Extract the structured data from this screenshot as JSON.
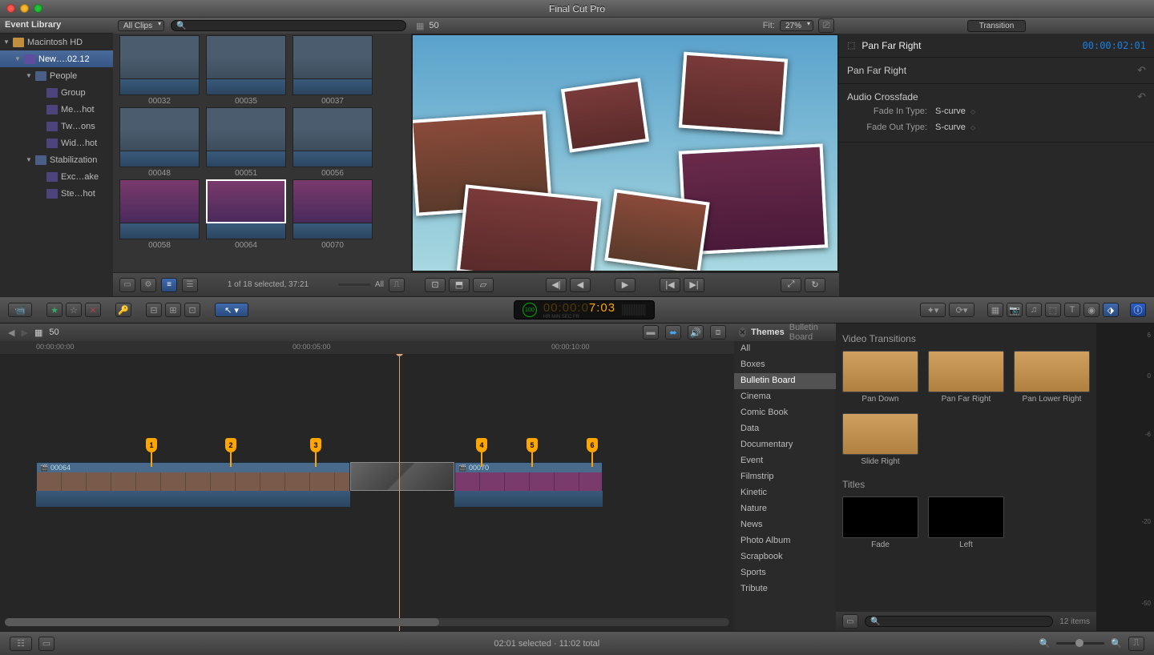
{
  "app": {
    "title": "Final Cut Pro"
  },
  "event_library": {
    "header": "Event Library",
    "tree": [
      {
        "icon": "drive",
        "label": "Macintosh HD",
        "indent": 0,
        "tri": true
      },
      {
        "icon": "event",
        "label": "New….02.12",
        "indent": 1,
        "tri": true,
        "sel": true
      },
      {
        "icon": "folder",
        "label": "People",
        "indent": 2,
        "tri": true
      },
      {
        "icon": "clip",
        "label": "Group",
        "indent": 3
      },
      {
        "icon": "clip",
        "label": "Me…hot",
        "indent": 3
      },
      {
        "icon": "clip",
        "label": "Tw…ons",
        "indent": 3
      },
      {
        "icon": "clip",
        "label": "Wid…hot",
        "indent": 3
      },
      {
        "icon": "folder",
        "label": "Stabilization",
        "indent": 2,
        "tri": true
      },
      {
        "icon": "clip",
        "label": "Exc…ake",
        "indent": 3
      },
      {
        "icon": "clip",
        "label": "Ste…hot",
        "indent": 3
      }
    ]
  },
  "browser": {
    "filter": "All Clips",
    "search_placeholder": "",
    "thumbs": [
      [
        {
          "name": "00032",
          "style": "crowd"
        },
        {
          "name": "00035",
          "style": "crowd"
        },
        {
          "name": "00037",
          "style": "crowd"
        }
      ],
      [
        {
          "name": "00048",
          "style": "crowd"
        },
        {
          "name": "00051",
          "style": "crowd"
        },
        {
          "name": "00056",
          "style": "crowd"
        }
      ],
      [
        {
          "name": "00058",
          "style": "stage"
        },
        {
          "name": "00064",
          "style": "stage",
          "sel": true
        },
        {
          "name": "00070",
          "style": "stage"
        }
      ]
    ],
    "footer": {
      "selection": "1 of 18 selected, 37:21",
      "all": "All"
    }
  },
  "viewer": {
    "title": "50",
    "fit": "Fit:",
    "zoom": "27%"
  },
  "inspector": {
    "tab": "Transition",
    "name": "Pan Far Right",
    "timecode": "00:00:02:01",
    "sections": [
      {
        "title": "Pan Far Right",
        "rows": []
      },
      {
        "title": "Audio Crossfade",
        "rows": [
          {
            "label": "Fade In Type:",
            "value": "S-curve"
          },
          {
            "label": "Fade Out Type:",
            "value": "S-curve"
          }
        ]
      }
    ]
  },
  "timecode_display": {
    "ring": "100",
    "time": "00:00:07:03",
    "sub": "HR   MIN   SEC   FR"
  },
  "timeline": {
    "project": "50",
    "ruler": [
      "00:00:00:00",
      "00:00:05:00",
      "00:00:10:00"
    ],
    "markers": [
      1,
      2,
      3,
      4,
      5,
      6
    ],
    "clips": [
      {
        "name": "00064"
      },
      {
        "name": "00070"
      }
    ]
  },
  "fx": {
    "header": "Themes",
    "subheader": "Bulletin Board",
    "categories": [
      "All",
      "Boxes",
      "Bulletin Board",
      "Cinema",
      "Comic Book",
      "Data",
      "Documentary",
      "Event",
      "Filmstrip",
      "Kinetic",
      "Nature",
      "News",
      "Photo Album",
      "Scrapbook",
      "Sports",
      "Tribute"
    ],
    "selected_category": "Bulletin Board",
    "sections": [
      {
        "title": "Video Transitions",
        "items": [
          {
            "name": "Pan Down",
            "style": "board"
          },
          {
            "name": "Pan Far Right",
            "style": "board"
          },
          {
            "name": "Pan Lower Right",
            "style": "board"
          },
          {
            "name": "Slide Right",
            "style": "board"
          }
        ]
      },
      {
        "title": "Titles",
        "items": [
          {
            "name": "Fade",
            "style": "dark"
          },
          {
            "name": "Left",
            "style": "dark"
          }
        ]
      }
    ],
    "footer_count": "12 items"
  },
  "meter_marks": [
    "6",
    "0",
    "-6",
    "-20",
    "-50"
  ],
  "status": {
    "text": "02:01 selected · 11:02 total"
  },
  "toolbar_icons": {
    "import": "⬇",
    "fav": "★",
    "unfav": "☆",
    "reject": "✕",
    "keyword": "🔑",
    "connect": "⊟",
    "insert": "⊞",
    "append": "⊡",
    "arrow": "↖",
    "magic": "✦",
    "retime": "⟳",
    "lib": "▦",
    "photo": "📷",
    "music": "♫",
    "trans": "⬚",
    "text": "T",
    "gen": "◉",
    "theme": "⬗",
    "info": "ⓘ"
  }
}
